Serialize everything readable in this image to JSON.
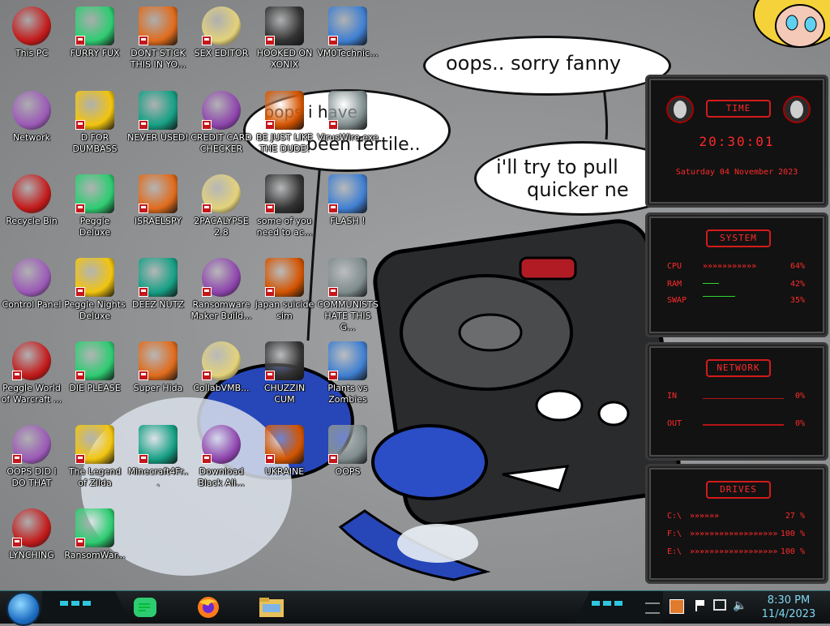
{
  "wallpaper": {
    "bubble1": "oops.. sorry fanny",
    "bubble2_line1": "i'll try to pull",
    "bubble2_line2": "quicker ne",
    "bubble3_line1": "oops i have",
    "bubble3_line2": "been fertile.."
  },
  "desktop_icons": [
    {
      "label": "This PC",
      "icon": "computer-icon"
    },
    {
      "label": "FURRY FUX",
      "icon": "firefox-icon"
    },
    {
      "label": "DONT STICK THIS IN YO...",
      "icon": "vlc-cone-icon"
    },
    {
      "label": "SEX EDITOR",
      "icon": "hxd-icon"
    },
    {
      "label": "HOOKED ON XONIX",
      "icon": "xonix-icon"
    },
    {
      "label": "VM0Technic...",
      "icon": "doctor-icon"
    },
    {
      "label": "Network",
      "icon": "alienware-network-icon"
    },
    {
      "label": "D FOR DUMBASS",
      "icon": "chat-icon"
    },
    {
      "label": "NEVER USED!",
      "icon": "devcpp-icon"
    },
    {
      "label": "CREDIT CARD CHECKER",
      "icon": "credit-card-icon"
    },
    {
      "label": "BE JUST LIKE THE DUDE!",
      "icon": "santa-icon"
    },
    {
      "label": "VirusWire.exe",
      "icon": "limewire-icon"
    },
    {
      "label": "Recycle Bin",
      "icon": "recycle-bin-icon"
    },
    {
      "label": "Peggle Deluxe",
      "icon": "peggle-icon"
    },
    {
      "label": "ISRAELSPY",
      "icon": "spy-window-icon"
    },
    {
      "label": "2PACALYPSE 2.8",
      "icon": "terminal-icon"
    },
    {
      "label": "some of you need to ac...",
      "icon": "dog-icon"
    },
    {
      "label": "FLASH !",
      "icon": "flash-icon"
    },
    {
      "label": "Control Panel",
      "icon": "control-panel-icon"
    },
    {
      "label": "Peggle Nights Deluxe",
      "icon": "peggle-nights-icon"
    },
    {
      "label": "DEEZ NUTZ",
      "icon": "stack-icon"
    },
    {
      "label": "Ransomware Maker Build...",
      "icon": "ransomware-maker-icon"
    },
    {
      "label": "japan suicide sim",
      "icon": "japan-sim-icon"
    },
    {
      "label": "COMMUNISTS HATE THIS G...",
      "icon": "money-bag-icon"
    },
    {
      "label": "Peggle World of Warcraft ...",
      "icon": "peggle-wow-icon"
    },
    {
      "label": "DIE PLEASE",
      "icon": "de-icon"
    },
    {
      "label": "Super Hida",
      "icon": "pixel-dog-icon"
    },
    {
      "label": "CollabVMB...",
      "icon": "collabvm-icon"
    },
    {
      "label": "CHUZZIN CUM",
      "icon": "chuzzle-icon"
    },
    {
      "label": "Plants vs Zombies",
      "icon": "pvz-icon"
    },
    {
      "label": "OOPS DID I DO THAT",
      "icon": "portrait-icon"
    },
    {
      "label": "The Legend of Zilda",
      "icon": "zelda-icon"
    },
    {
      "label": "Minecraft4Fr...",
      "icon": "minecraft-icon"
    },
    {
      "label": "Download Black Ali...",
      "icon": "alienware-download-icon"
    },
    {
      "label": "UKRAINE",
      "icon": "radiation-icon"
    },
    {
      "label": "OOPS",
      "icon": "oops-icon"
    },
    {
      "label": "LYNCHING",
      "icon": "noose-icon"
    },
    {
      "label": "RansomWar...",
      "icon": "skull-icon"
    }
  ],
  "gadgets": {
    "time": {
      "title": "TIME",
      "clock": "20:30:01",
      "date": "Saturday 04 November 2023"
    },
    "system": {
      "title": "SYSTEM",
      "rows": [
        {
          "key": "CPU",
          "value": "64%",
          "bar": "»»»»»»»»»»»"
        },
        {
          "key": "RAM",
          "value": "42%",
          "bar": ""
        },
        {
          "key": "SWAP",
          "value": "35%",
          "bar": ""
        }
      ]
    },
    "network": {
      "title": "NETWORK",
      "rows": [
        {
          "key": "IN",
          "value": "0%"
        },
        {
          "key": "OUT",
          "value": "0%"
        }
      ]
    },
    "drives": {
      "title": "DRIVES",
      "rows": [
        {
          "key": "C:\\",
          "value": "27 %",
          "bar": "»»»»»»"
        },
        {
          "key": "F:\\",
          "value": "100 %",
          "bar": "»»»»»»»»»»»»»»»»»»"
        },
        {
          "key": "E:\\",
          "value": "100 %",
          "bar": "»»»»»»»»»»»»»»»»»»"
        }
      ]
    }
  },
  "taskbar": {
    "pinned": [
      {
        "name": "chat-app",
        "icon": "chat-icon"
      },
      {
        "name": "firefox",
        "icon": "firefox-icon"
      },
      {
        "name": "file-explorer",
        "icon": "folder-icon"
      }
    ],
    "clock_time": "8:30 PM",
    "clock_date": "11/4/2023",
    "accent": "#2fc7e0"
  }
}
